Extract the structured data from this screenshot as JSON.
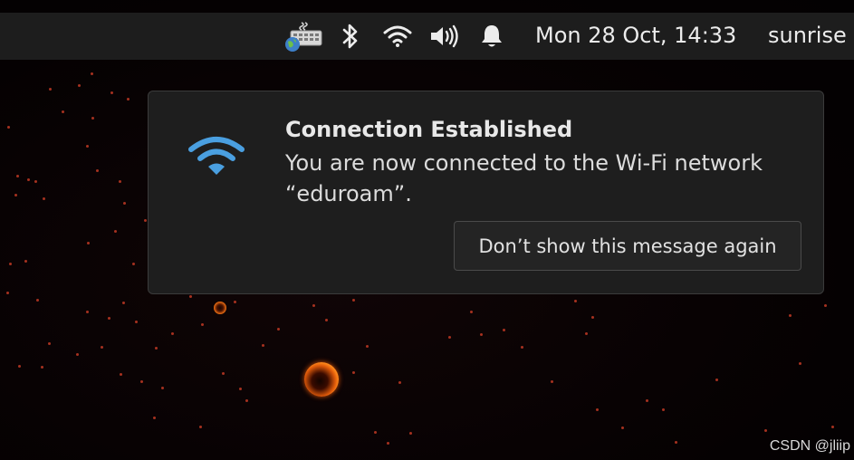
{
  "top_bar": {
    "tray_icons": [
      "keyboard-layout-icon",
      "bluetooth-icon",
      "wifi-icon",
      "volume-icon",
      "bell-icon"
    ],
    "clock": "Mon 28 Oct, 14:33",
    "user": "sunrise"
  },
  "notification": {
    "icon": "wifi-icon",
    "title": "Connection Established",
    "body_line1": "You are now connected to the Wi-Fi network",
    "body_line2": "“eduroam”.",
    "dismiss_label": "Don’t show this message again"
  },
  "watermark": "CSDN @jliip",
  "colors": {
    "panel_bg": "#1d1d1d",
    "notification_bg": "#1e1e1e",
    "wifi_accent": "#4a9fe0",
    "star": "#c23a25",
    "planet": "#e05a0a"
  }
}
